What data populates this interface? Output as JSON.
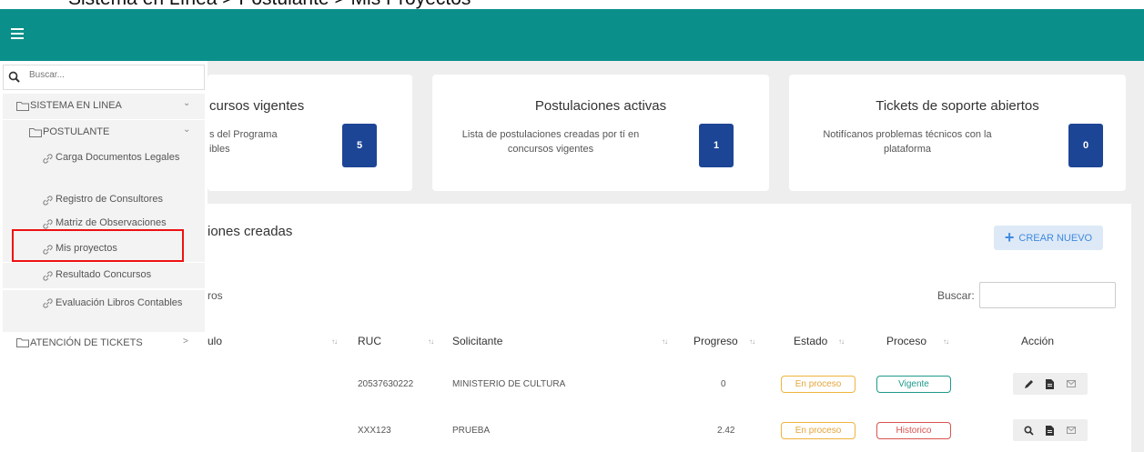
{
  "breadcrumb": "Sistema en Línea  >  Postulante  >  Mis Proyectos",
  "colors": {
    "topbar": "#0b8f8a",
    "badge": "#1d4596",
    "highlight": "#e11111",
    "accent": "#3f8ae0"
  },
  "topbar": {
    "menu_icon": "hamburger-icon"
  },
  "sidebar": {
    "search_placeholder": "Buscar...",
    "sections": [
      {
        "label": "SISTEMA EN LINEA",
        "icon": "folder-icon",
        "chevron": "⌄"
      },
      {
        "label": "POSTULANTE",
        "icon": "folder-icon",
        "chevron": "⌄"
      }
    ],
    "items": [
      {
        "label": "Carga Documentos Legales"
      },
      {
        "label": "Registro de Consultores"
      },
      {
        "label": "Matriz de Observaciones"
      },
      {
        "label": "Mis proyectos"
      },
      {
        "label": "Resultado Concursos"
      },
      {
        "label": "Evaluación Libros Contables"
      }
    ],
    "tickets": {
      "label": "ATENCIÓN DE TICKETS",
      "chevron": ">"
    }
  },
  "cards": [
    {
      "title": "cursos vigentes",
      "desc1": "s del Programa",
      "desc2": "ibles",
      "value": "5"
    },
    {
      "title": "Postulaciones activas",
      "desc1": "Lista de postulaciones creadas por tí en",
      "desc2": "concursos vigentes",
      "value": "1"
    },
    {
      "title": "Tickets de soporte abiertos",
      "desc1": "Notifícanos problemas técnicos con la",
      "desc2": "plataforma",
      "value": "0"
    }
  ],
  "panel": {
    "title": "iones creadas",
    "new_button": "CREAR NUEVO",
    "registros": "ros",
    "search_label": "Buscar:",
    "columns": [
      "ulo",
      "RUC",
      "Solicitante",
      "Progreso",
      "Estado",
      "Proceso",
      "Acción"
    ],
    "rows": [
      {
        "ruc": "20537630222",
        "solicitante": "MINISTERIO DE CULTURA",
        "progreso": "0",
        "estado": "En proceso",
        "proceso": "Vigente",
        "actions": [
          "pencil-icon",
          "document-icon",
          "mail-icon"
        ]
      },
      {
        "ruc": "XXX123",
        "solicitante": "PRUEBA",
        "progreso": "2.42",
        "estado": "En proceso",
        "proceso": "Historico",
        "actions": [
          "search-icon",
          "document-icon",
          "mail-icon"
        ]
      }
    ]
  }
}
